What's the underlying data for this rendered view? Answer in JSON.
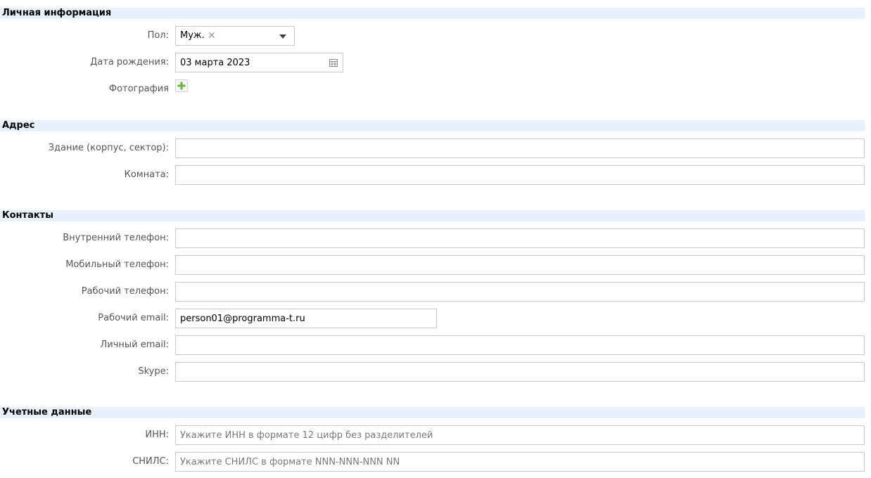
{
  "personal": {
    "header": "Личная информация",
    "gender_label": "Пол:",
    "gender_value": "Муж.",
    "birthdate_label": "Дата рождения:",
    "birthdate_value": "03 марта 2023",
    "photo_label": "Фотография"
  },
  "address": {
    "header": "Адрес",
    "building_label": "Здание (корпус, сектор):",
    "building_value": "",
    "room_label": "Комната:",
    "room_value": ""
  },
  "contacts": {
    "header": "Контакты",
    "internal_phone_label": "Внутренний телефон:",
    "internal_phone_value": "",
    "mobile_phone_label": "Мобильный телефон:",
    "mobile_phone_value": "",
    "work_phone_label": "Рабочий телефон:",
    "work_phone_value": "",
    "work_email_label": "Рабочий email:",
    "work_email_value": "person01@programma-t.ru",
    "personal_email_label": "Личный email:",
    "personal_email_value": "",
    "skype_label": "Skype:",
    "skype_value": ""
  },
  "credentials": {
    "header": "Учетные данные",
    "inn_label": "ИНН:",
    "inn_placeholder": "Укажите ИНН в формате 12 цифр без разделителей",
    "snils_label": "СНИЛС:",
    "snils_placeholder": "Укажите СНИЛС в формате NNN-NNN-NNN NN"
  },
  "icons": {
    "clear": "close-icon",
    "dropdown": "chevron-down-icon",
    "calendar": "calendar-icon",
    "add": "plus-icon"
  },
  "colors": {
    "section_header_bg": "#e8f1fb",
    "add_icon": "#6cb33e",
    "border": "#c8c8c8"
  }
}
